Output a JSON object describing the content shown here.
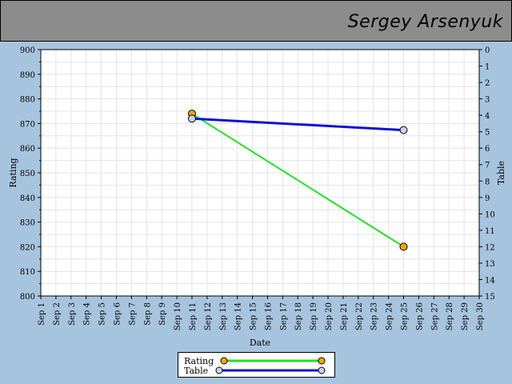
{
  "header": {
    "title": "Sergey Arsenyuk"
  },
  "chart_data": {
    "type": "line",
    "xlabel": "Date",
    "ylabel": "Rating",
    "y2label": "Table",
    "x_ticks": [
      "Sep 1",
      "Sep 2",
      "Sep 3",
      "Sep 4",
      "Sep 5",
      "Sep 6",
      "Sep 7",
      "Sep 8",
      "Sep 9",
      "Sep 10",
      "Sep 11",
      "Sep 12",
      "Sep 13",
      "Sep 14",
      "Sep 15",
      "Sep 16",
      "Sep 17",
      "Sep 18",
      "Sep 19",
      "Sep 20",
      "Sep 21",
      "Sep 22",
      "Sep 23",
      "Sep 24",
      "Sep 25",
      "Sep 26",
      "Sep 27",
      "Sep 28",
      "Sep 29",
      "Sep 30"
    ],
    "xlim": [
      1,
      30
    ],
    "ylim": [
      800,
      900
    ],
    "y_ticks": [
      800,
      810,
      820,
      830,
      840,
      850,
      860,
      870,
      880,
      890,
      900
    ],
    "y2lim": [
      0,
      15
    ],
    "y2_ticks": [
      0,
      1,
      2,
      3,
      4,
      5,
      6,
      7,
      8,
      9,
      10,
      11,
      12,
      13,
      14,
      15
    ],
    "y2_inverted": true,
    "grid": true,
    "legend_position": "bottom",
    "series": [
      {
        "name": "Rating",
        "axis": "left",
        "x": [
          11,
          25
        ],
        "y": [
          874,
          820
        ],
        "line_color": "#22e022",
        "marker_color": "#f5a800"
      },
      {
        "name": "Table",
        "axis": "right",
        "x": [
          11,
          25
        ],
        "y": [
          4.2,
          4.9
        ],
        "line_color": "#0f0fd6",
        "marker_color": "#c8d4e6"
      }
    ]
  }
}
